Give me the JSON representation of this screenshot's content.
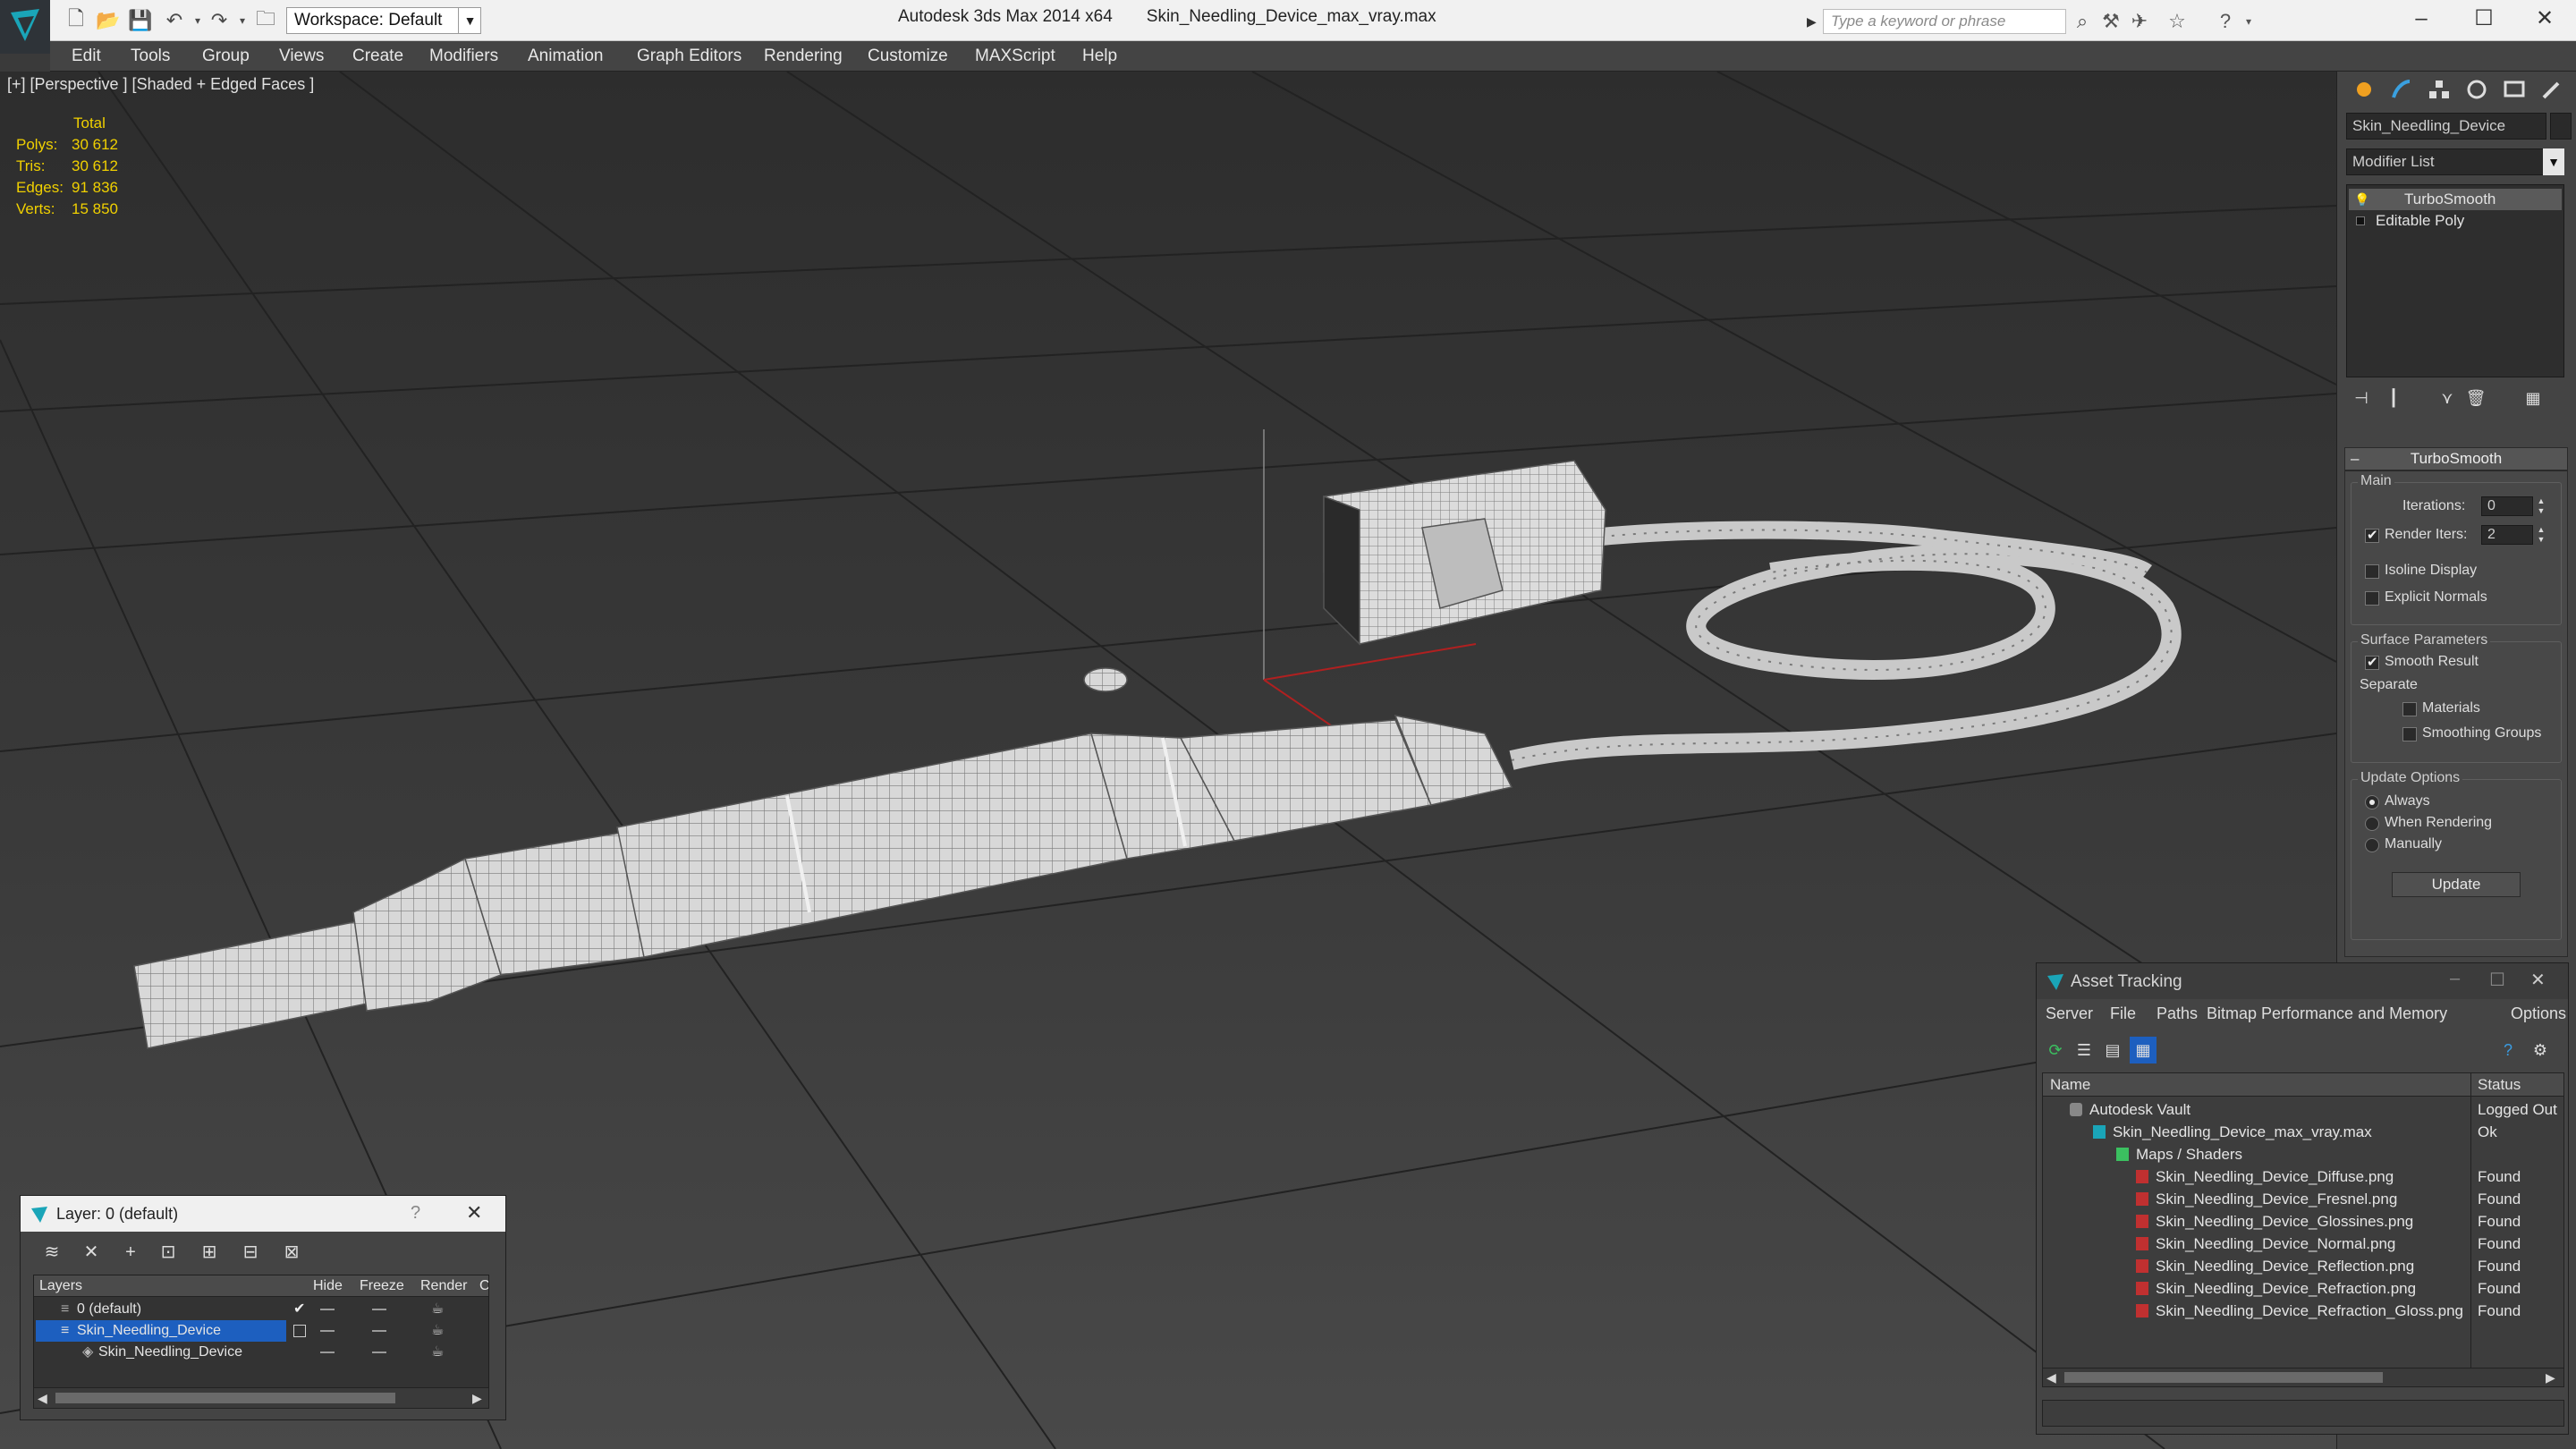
{
  "titlebar": {
    "app_title": "Autodesk 3ds Max  2014 x64",
    "file_title": "Skin_Needling_Device_max_vray.max",
    "workspace": "Workspace: Default",
    "search_placeholder": "Type a keyword or phrase"
  },
  "menu": [
    "Edit",
    "Tools",
    "Group",
    "Views",
    "Create",
    "Modifiers",
    "Animation",
    "Graph Editors",
    "Rendering",
    "Customize",
    "MAXScript",
    "Help"
  ],
  "viewport": {
    "label": "[+] [Perspective ] [Shaded + Edged Faces ]",
    "stats": {
      "header": "Total",
      "rows": [
        {
          "k": "Polys:",
          "v": "30 612"
        },
        {
          "k": "Tris:",
          "v": "30 612"
        },
        {
          "k": "Edges:",
          "v": "91 836"
        },
        {
          "k": "Verts:",
          "v": "15 850"
        }
      ]
    }
  },
  "command_panel": {
    "object_name": "Skin_Needling_Device",
    "modifier_list": "Modifier List",
    "stack": [
      "TurboSmooth",
      "Editable Poly"
    ],
    "turbosmooth": {
      "title": "TurboSmooth",
      "main": "Main",
      "iterations_label": "Iterations:",
      "iterations": "0",
      "render_iters_label": "Render Iters:",
      "render_iters": "2",
      "render_iters_checked": true,
      "isoline": "Isoline Display",
      "explicit_normals": "Explicit Normals",
      "surface_params": "Surface Parameters",
      "smooth_result": "Smooth Result",
      "separate": "Separate",
      "materials": "Materials",
      "smoothing_groups": "Smoothing Groups",
      "update_options": "Update Options",
      "always": "Always",
      "when_rendering": "When Rendering",
      "manually": "Manually",
      "update_btn": "Update"
    }
  },
  "asset_tracking": {
    "title": "Asset Tracking",
    "menu": [
      "Server",
      "File",
      "Paths",
      "Bitmap Performance and Memory",
      "Options"
    ],
    "columns": [
      "Name",
      "Status"
    ],
    "rows": [
      {
        "name": "Autodesk Vault",
        "status": "Logged Out",
        "indent": 0,
        "icon": "vault-icon"
      },
      {
        "name": "Skin_Needling_Device_max_vray.max",
        "status": "Ok",
        "indent": 1,
        "icon": "max-file-icon"
      },
      {
        "name": "Maps / Shaders",
        "status": "",
        "indent": 2,
        "icon": "maps-folder-icon"
      },
      {
        "name": "Skin_Needling_Device_Diffuse.png",
        "status": "Found",
        "indent": 3,
        "icon": "png-icon"
      },
      {
        "name": "Skin_Needling_Device_Fresnel.png",
        "status": "Found",
        "indent": 3,
        "icon": "png-icon"
      },
      {
        "name": "Skin_Needling_Device_Glossines.png",
        "status": "Found",
        "indent": 3,
        "icon": "png-icon"
      },
      {
        "name": "Skin_Needling_Device_Normal.png",
        "status": "Found",
        "indent": 3,
        "icon": "png-icon"
      },
      {
        "name": "Skin_Needling_Device_Reflection.png",
        "status": "Found",
        "indent": 3,
        "icon": "png-icon"
      },
      {
        "name": "Skin_Needling_Device_Refraction.png",
        "status": "Found",
        "indent": 3,
        "icon": "png-icon"
      },
      {
        "name": "Skin_Needling_Device_Refraction_Gloss.png",
        "status": "Found",
        "indent": 3,
        "icon": "png-icon"
      }
    ]
  },
  "layers": {
    "title": "Layer: 0 (default)",
    "help": "?",
    "columns": [
      "Layers",
      "Hide",
      "Freeze",
      "Render",
      "C"
    ],
    "rows": [
      {
        "name": "0 (default)",
        "selected": false,
        "indent": 1
      },
      {
        "name": "Skin_Needling_Device",
        "selected": true,
        "indent": 1
      },
      {
        "name": "Skin_Needling_Device",
        "selected": false,
        "indent": 2
      }
    ]
  },
  "colors": {
    "accent": "#1d5fbf",
    "stats_text": "#f0d000",
    "viewport_bg": "#3a3a3a"
  }
}
